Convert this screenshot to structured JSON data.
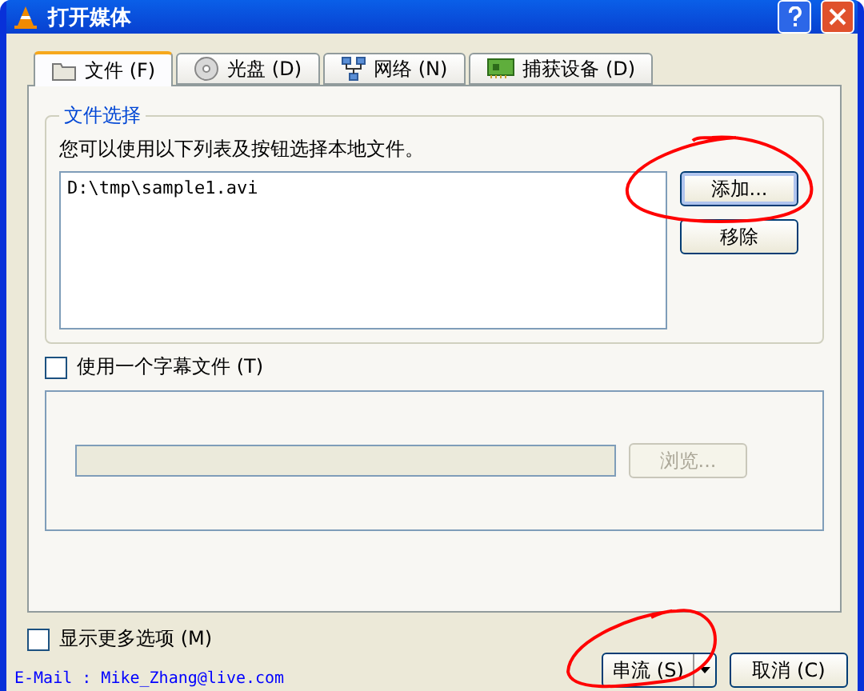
{
  "window": {
    "title": "打开媒体"
  },
  "tabs": [
    {
      "label": "文件 (F)",
      "selected": true
    },
    {
      "label": "光盘 (D)",
      "selected": false
    },
    {
      "label": "网络 (N)",
      "selected": false
    },
    {
      "label": "捕获设备 (D)",
      "selected": false
    }
  ],
  "file_selection": {
    "title": "文件选择",
    "hint": "您可以使用以下列表及按钮选择本地文件。",
    "files": [
      "D:\\tmp\\sample1.avi"
    ],
    "buttons": [
      {
        "label": "添加...",
        "focused": true
      },
      {
        "label": "移除",
        "focused": false
      }
    ]
  },
  "subtitle": {
    "label": "使用一个字幕文件 (T)",
    "checked": false,
    "browse": {
      "label": "浏览...",
      "disabled": true
    }
  },
  "more_options": {
    "label": "显示更多选项 (M)",
    "checked": false
  },
  "email": "E-Mail : Mike_Zhang@live.com",
  "actions": [
    {
      "label": "串流 (S)",
      "kind": "split"
    },
    {
      "label": "取消 (C)",
      "kind": "plain"
    }
  ]
}
